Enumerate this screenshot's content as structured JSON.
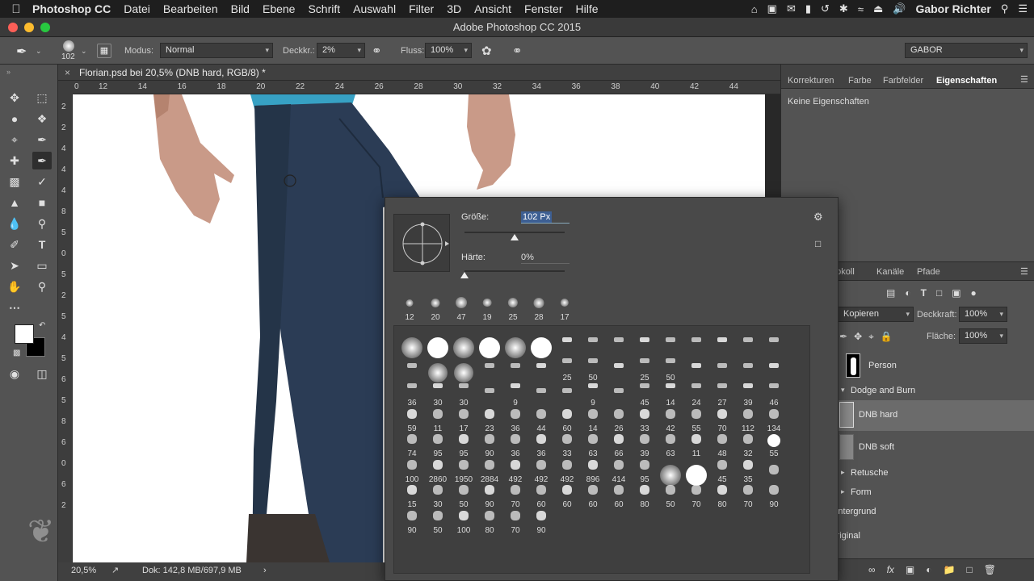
{
  "menubar": {
    "app": "Photoshop CC",
    "menus": [
      "Datei",
      "Bearbeiten",
      "Bild",
      "Ebene",
      "Schrift",
      "Auswahl",
      "Filter",
      "3D",
      "Ansicht",
      "Fenster",
      "Hilfe"
    ],
    "user": "Gabor Richter"
  },
  "window": {
    "title": "Adobe Photoshop CC 2015"
  },
  "options": {
    "brush_size": "102",
    "modus_label": "Modus:",
    "modus_value": "Normal",
    "deckkr_label": "Deckkr.:",
    "deckkr_value": "2%",
    "fluss_label": "Fluss:",
    "fluss_value": "100%",
    "workspace": "GABOR"
  },
  "document": {
    "tab_title": "Florian.psd bei 20,5% (DNB hard, RGB/8) *",
    "zoom": "20,5%",
    "doc_info": "Dok: 142,8 MB/697,9 MB",
    "ruler_h": [
      "0",
      "12",
      "14",
      "16",
      "18",
      "20",
      "22",
      "24",
      "26",
      "28",
      "30",
      "32",
      "34",
      "36",
      "38",
      "40",
      "42",
      "44"
    ],
    "ruler_v": [
      "2",
      "2",
      "4",
      "4",
      "4",
      "8",
      "5",
      "0",
      "5",
      "2",
      "5",
      "4",
      "5",
      "6",
      "5",
      "8",
      "6",
      "0",
      "6",
      "2"
    ]
  },
  "brush_popup": {
    "size_label": "Größe:",
    "size_value": "102 Px",
    "size_fraction": 0.5,
    "hardness_label": "Härte:",
    "hardness_value": "0%",
    "hardness_fraction": 0.0,
    "recent": [
      "12",
      "20",
      "47",
      "19",
      "25",
      "28",
      "17"
    ],
    "preset_rows": [
      [
        "",
        "",
        "",
        "",
        "",
        "",
        "",
        "",
        "",
        "",
        "",
        "",
        "",
        "",
        ""
      ],
      [
        "",
        "",
        "",
        "",
        "",
        "",
        "25",
        "50",
        "",
        "25",
        "50",
        "",
        "",
        "",
        ""
      ],
      [
        "36",
        "30",
        "30",
        "",
        "9",
        "",
        "",
        "9",
        "",
        "45",
        "14",
        "24",
        "27",
        "39",
        "46"
      ],
      [
        "59",
        "11",
        "17",
        "23",
        "36",
        "44",
        "60",
        "14",
        "26",
        "33",
        "42",
        "55",
        "70",
        "112",
        "134"
      ],
      [
        "74",
        "95",
        "95",
        "90",
        "36",
        "36",
        "33",
        "63",
        "66",
        "39",
        "63",
        "11",
        "48",
        "32",
        "55"
      ],
      [
        "100",
        "2860",
        "1950",
        "2884",
        "492",
        "492",
        "492",
        "896",
        "414",
        "95",
        "",
        "",
        "45",
        "35",
        ""
      ],
      [
        "15",
        "30",
        "50",
        "90",
        "70",
        "60",
        "60",
        "60",
        "60",
        "80",
        "50",
        "70",
        "80",
        "70",
        "90"
      ],
      [
        "90",
        "50",
        "100",
        "80",
        "70",
        "90",
        "",
        "",
        "",
        "",
        "",
        "",
        "",
        "",
        ""
      ]
    ]
  },
  "right_panel": {
    "tabs_top": [
      "Korrekturen",
      "Farbe",
      "Farbfelder",
      "Eigenschaften"
    ],
    "properties_text": "Keine Eigenschaften",
    "tabs_layers": [
      "Protokoll",
      "Kanäle",
      "Pfade"
    ],
    "blend_mode": "Kopieren",
    "opacity_label": "Deckkraft:",
    "opacity_value": "100%",
    "fill_label": "Fläche:",
    "fill_value": "100%",
    "layers": [
      "Person",
      "Dodge and Burn",
      "DNB hard",
      "DNB soft",
      "Retusche",
      "Form",
      "Hintergrund",
      "Original"
    ],
    "selected_layer": "DNB hard"
  },
  "colors": {
    "panel": "#535353",
    "dark": "#282828",
    "selected_layer": "#6b6b6b",
    "jeans": "#2c3e55",
    "skin": "#c99a88"
  }
}
